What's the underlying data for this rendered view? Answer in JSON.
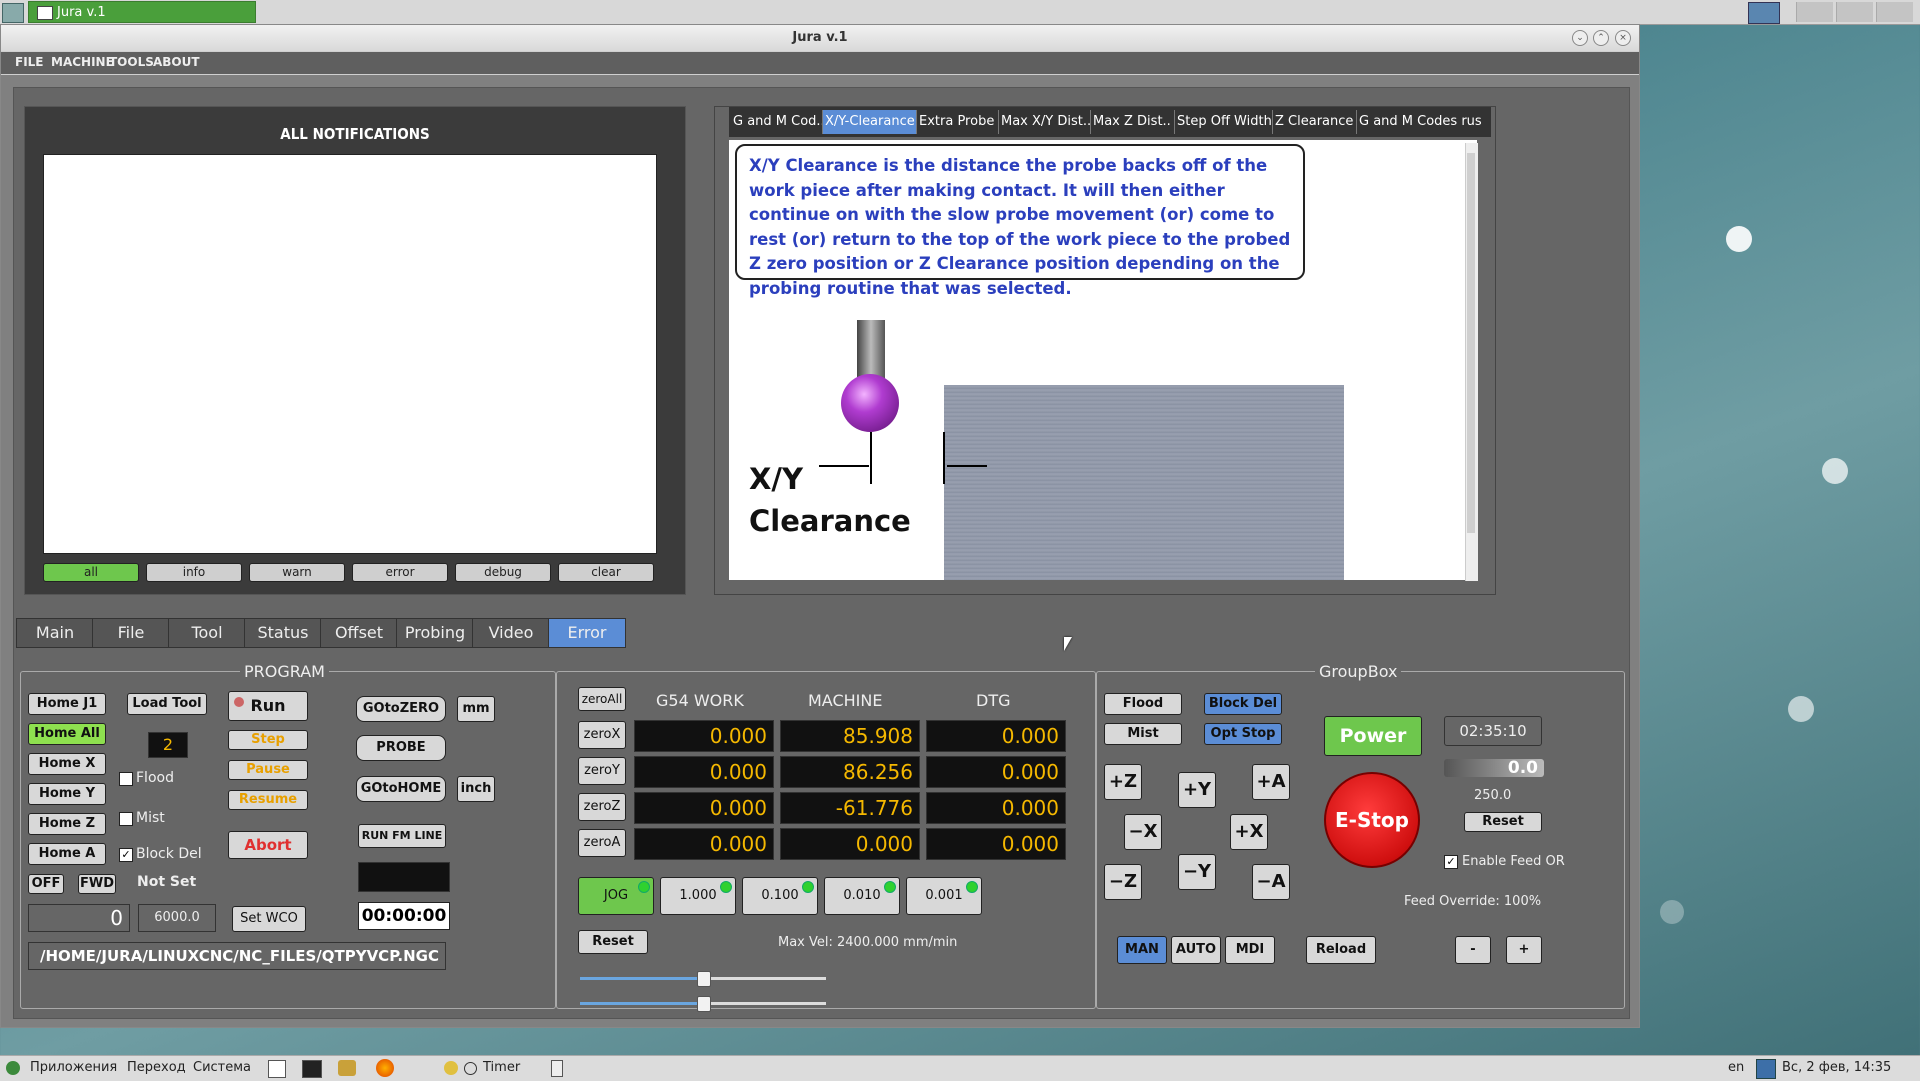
{
  "taskbar": {
    "app_title": "Jura v.1"
  },
  "window": {
    "title": "Jura v.1",
    "minimize": "⌄",
    "maximize": "⌃",
    "close": "×"
  },
  "menubar": [
    "FILE",
    "MACHINE",
    "TOOLS",
    "ABOUT"
  ],
  "notifications": {
    "title": "ALL NOTIFICATIONS",
    "filters": [
      "all",
      "info",
      "warn",
      "error",
      "debug",
      "clear"
    ],
    "selected": "all"
  },
  "help": {
    "tabs": [
      "G and M Cod..",
      "X/Y-Clearance",
      "Extra Probe",
      "Max X/Y Dist..",
      "Max Z Dist..",
      "Step Off Width",
      "Z Clearance",
      "G and M Codes rus"
    ],
    "active_tab": "X/Y-Clearance",
    "text": "X/Y Clearance is the distance the probe backs off of the work piece after making contact.  It will then either continue on with the slow probe movement (or) come to rest (or) return to the top of the work piece to the probed Z zero position or Z Clearance position depending on the probing routine that was selected.",
    "diagram_label_1": "X/Y",
    "diagram_label_2": "Clearance"
  },
  "main_tabs": [
    "Main",
    "File",
    "Tool",
    "Status",
    "Offset",
    "Probing",
    "Video",
    "Error"
  ],
  "active_main_tab": "Error",
  "program": {
    "title": "PROGRAM",
    "home_buttons": [
      "Home J1",
      "Home All",
      "Home X",
      "Home Y",
      "Home Z",
      "Home A"
    ],
    "load_tool": "Load Tool",
    "tool_number": "2",
    "flood": "Flood",
    "mist": "Mist",
    "block_del": "Block Del",
    "run": "Run",
    "step": "Step",
    "pause": "Pause",
    "resume": "Resume",
    "abort": "Abort",
    "goto_zero": "GOtoZERO",
    "probe": "PROBE",
    "goto_home": "GOtoHOME",
    "mm": "mm",
    "inch": "inch",
    "run_fm_line": "RUN FM LINE",
    "timer": "00:00:00",
    "spindle_off": "OFF",
    "spindle_fwd": "FWD",
    "not_set": "Not Set",
    "spindle_speed": "0",
    "spindle_setpoint": "6000.0",
    "set_wco": "Set WCO",
    "file_path": "/HOME/JURA/LINUXCNC/NC_FILES/QTPYVCP.NGC"
  },
  "dro": {
    "headers": [
      "G54 WORK",
      "MACHINE",
      "DTG"
    ],
    "zero_all": "zeroAll",
    "rows": [
      {
        "label": "zeroX",
        "work": "0.000",
        "machine": "85.908",
        "dtg": "0.000"
      },
      {
        "label": "zeroY",
        "work": "0.000",
        "machine": "86.256",
        "dtg": "0.000"
      },
      {
        "label": "zeroZ",
        "work": "0.000",
        "machine": "-61.776",
        "dtg": "0.000"
      },
      {
        "label": "zeroA",
        "work": "0.000",
        "machine": "0.000",
        "dtg": "0.000"
      }
    ],
    "jog_steps": [
      "JOG",
      "1.000",
      "0.100",
      "0.010",
      "0.001"
    ],
    "reset": "Reset",
    "max_vel": "Max Vel: 2400.000 mm/min",
    "slider1_value": 0.5,
    "slider2_value": 0.5
  },
  "groupbox": {
    "title": "GroupBox",
    "flood": "Flood",
    "mist": "Mist",
    "block_del": "Block Del",
    "opt_stop": "Opt Stop",
    "power": "Power",
    "clock": "02:35:10",
    "feed_value": "0.0",
    "feed_rate": "250.0",
    "reset": "Reset",
    "estop": "E-Stop",
    "enable_feed_or": "Enable Feed OR",
    "feed_override": "Feed Override: 100%",
    "jog": {
      "pz": "+Z",
      "py": "+Y",
      "pa": "+A",
      "mx": "−X",
      "px": "+X",
      "mz": "−Z",
      "my": "−Y",
      "ma": "−A"
    },
    "modes": [
      "MAN",
      "AUTO",
      "MDI"
    ],
    "reload": "Reload",
    "minus": "-",
    "plus": "+"
  },
  "bottom_taskbar": {
    "apps": "Приложения",
    "places": "Переход",
    "system": "Система",
    "timer": "Timer",
    "lang": "en",
    "datetime": "Вс,  2 фев, 14:35"
  },
  "colors": {
    "accent": "#5b8dd6",
    "green": "#6ec74d",
    "dro_text": "#f5b800",
    "estop": "#e02020"
  }
}
